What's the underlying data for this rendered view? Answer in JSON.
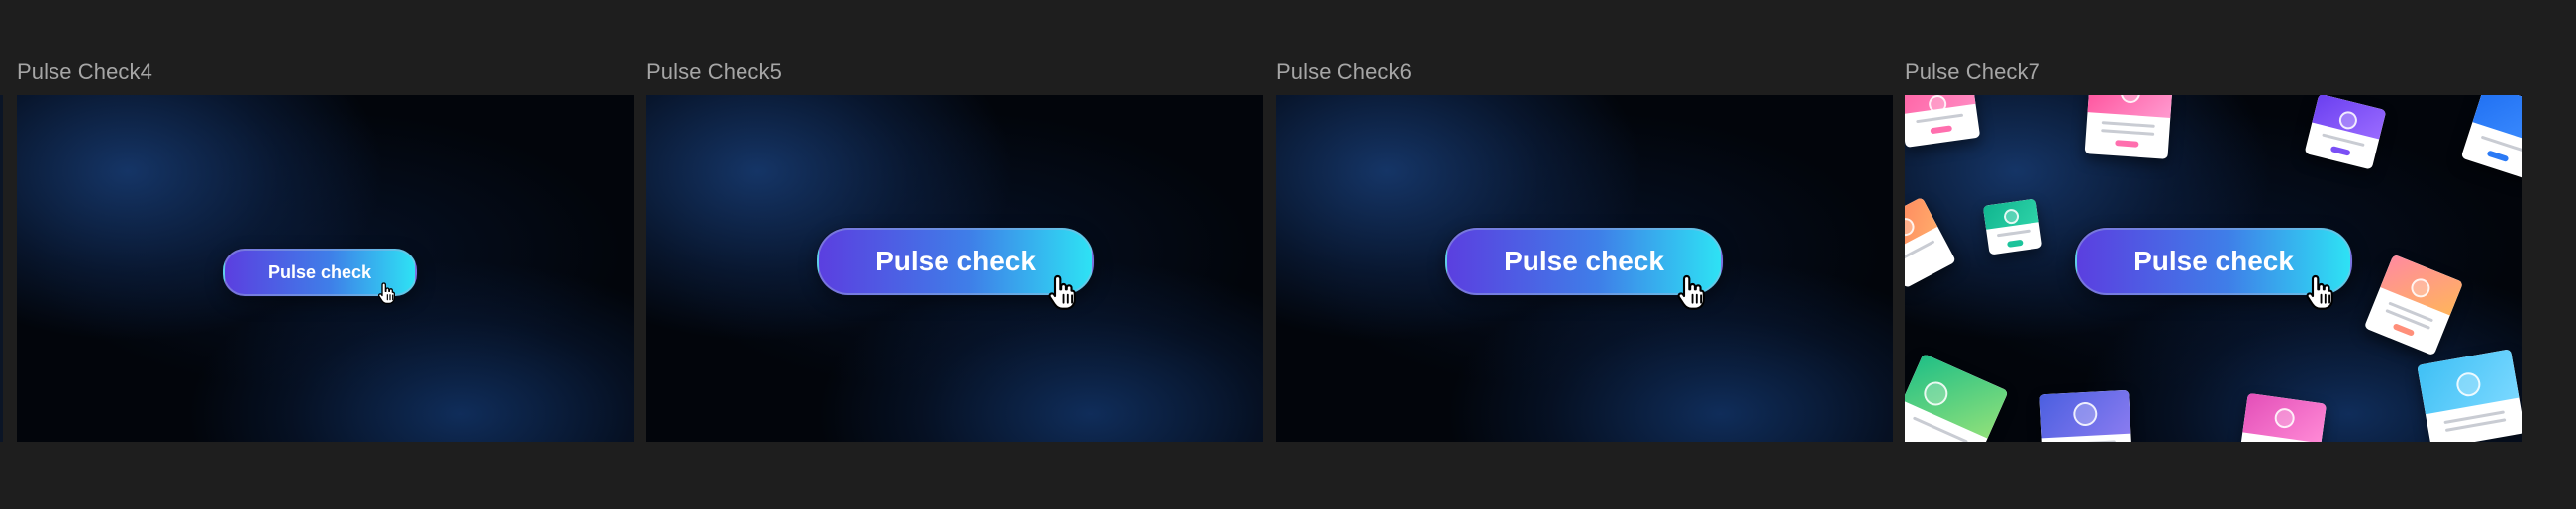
{
  "frames": [
    {
      "label": "Pulse Check4",
      "button_text": "Pulse check"
    },
    {
      "label": "Pulse Check5",
      "button_text": "Pulse check"
    },
    {
      "label": "Pulse Check6",
      "button_text": "Pulse check"
    },
    {
      "label": "Pulse Check7",
      "button_text": "Pulse check"
    }
  ],
  "colors": {
    "canvas_bg": "#1e1e1e",
    "label_text": "#a6a6a6",
    "pill_start": "#5b3fe0",
    "pill_end": "#2ee2f4",
    "frame_bg": "#02050b",
    "frame_glow": "#173a70"
  },
  "icons": {
    "cursor": "pointing-hand-cursor-icon"
  }
}
